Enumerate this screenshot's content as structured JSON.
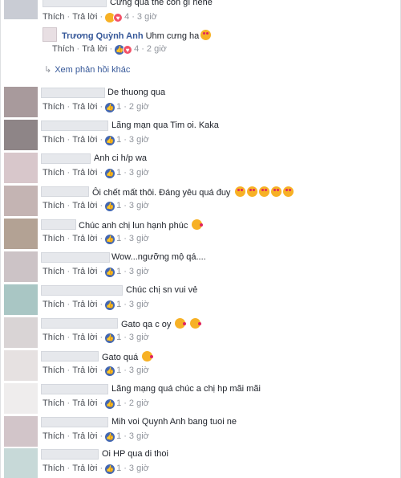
{
  "actions": {
    "like": "Thích",
    "reply": "Trả lời",
    "sep": "·"
  },
  "top_partial": {
    "text": "Cưng quá thế còn gì hehe",
    "count": "4",
    "time": "3 giờ"
  },
  "reply_comment": {
    "author": "Trương Quỳnh Anh",
    "text": "Uhm cưng ha",
    "count": "4",
    "time": "2 giờ"
  },
  "more_replies": "Xem phản hồi khác",
  "comments": [
    {
      "text": "De thuong qua",
      "count": "1",
      "time": "2 giờ"
    },
    {
      "text": "Lãng mạn qua Tim oi. Kaka",
      "count": "1",
      "time": "3 giờ"
    },
    {
      "text": "Anh ci h/p wa",
      "count": "1",
      "time": "3 giờ"
    },
    {
      "text": "Ôi chết mất thôi. Đáng yêu quá đuy",
      "count": "1",
      "time": "3 giờ"
    },
    {
      "text": "Chúc anh chị lun hạnh phúc",
      "count": "1",
      "time": "3 giờ"
    },
    {
      "text": "Wow...ngưỡng mộ qá....",
      "count": "1",
      "time": "3 giờ"
    },
    {
      "text": "Chúc chị sn vui vẻ",
      "count": "1",
      "time": "3 giờ"
    },
    {
      "text": "Gato qa c oy",
      "count": "1",
      "time": "3 giờ"
    },
    {
      "text": "Gato quá",
      "count": "1",
      "time": "3 giờ"
    },
    {
      "text": "Lãng mạng quá chúc a chị hp mãi mãi",
      "count": "1",
      "time": "2 giờ"
    },
    {
      "text": "Mih voi Quynh Anh bang tuoi ne",
      "count": "1",
      "time": "3 giờ"
    },
    {
      "text": "Oi HP qua di thoi",
      "count": "1",
      "time": "3 giờ"
    }
  ],
  "colors": {
    "link": "#365899",
    "meta": "#90949c",
    "like": "#4267b2",
    "love": "#f25268"
  }
}
